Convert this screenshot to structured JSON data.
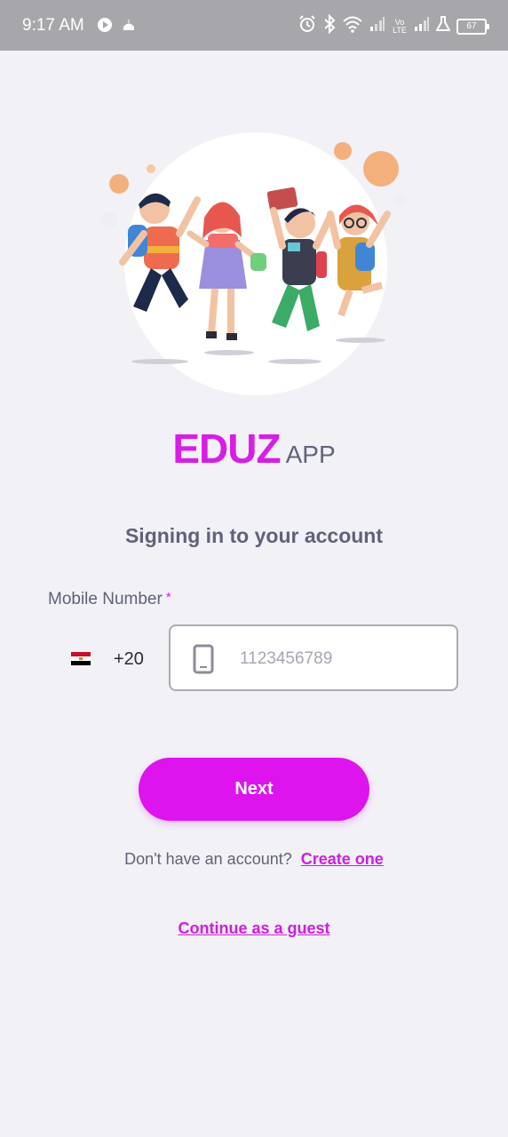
{
  "status_bar": {
    "time": "9:17 AM",
    "battery": "67",
    "network_label": "Vo\nLTE"
  },
  "brand": {
    "name": "EDUZ",
    "suffix": "APP",
    "accent_color": "#d61ee6"
  },
  "login": {
    "heading": "Signing in to your account",
    "mobile_label": "Mobile Number",
    "required_mark": "*",
    "country_code": "+20",
    "country_flag": "egypt-flag-icon",
    "phone_placeholder": "1123456789",
    "phone_value": "",
    "next_label": "Next",
    "no_account_text": "Don't have an account?",
    "create_label": "Create one",
    "guest_label": "Continue as a guest"
  },
  "colors": {
    "background": "#f2f1f6",
    "button": "#dd14ee",
    "status_bar": "#a7a7ab"
  }
}
